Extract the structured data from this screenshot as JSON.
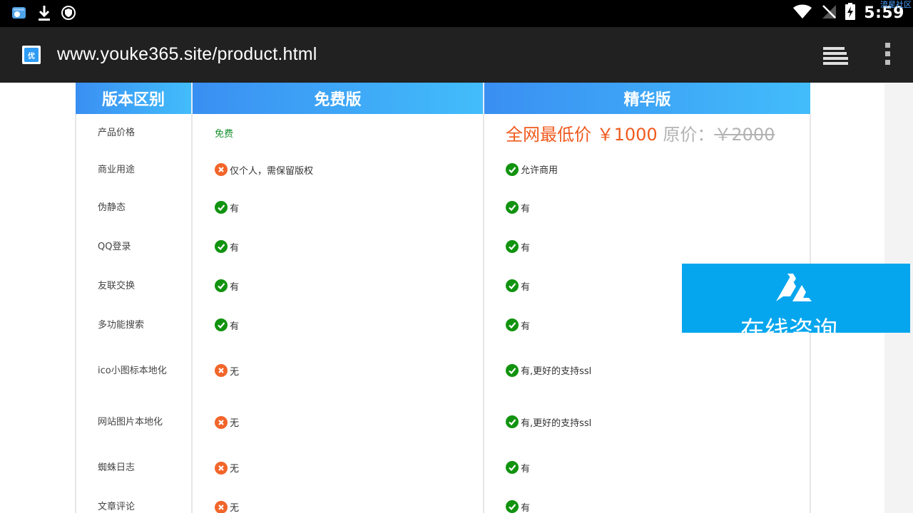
{
  "status_bar": {
    "time": "5:59",
    "corner_text": "流星社区",
    "left_icons": [
      "gallery-app-icon",
      "download-icon",
      "shield-icon"
    ],
    "right_icons": [
      "wifi-icon",
      "no-signal-icon",
      "battery-charging-icon"
    ]
  },
  "browser": {
    "url": "www.youke365.site/product.html",
    "favicon_text": "优"
  },
  "table": {
    "headers": [
      "版本区别",
      "免费版",
      "精华版"
    ],
    "price_row": {
      "label": "产品价格",
      "free": "免费",
      "premium_price": "全网最低价 ￥1000",
      "premium_original_label": "原价：",
      "premium_original_price": "￥2000"
    },
    "rows": [
      {
        "label": "商业用途",
        "free": {
          "ok": false,
          "text": "仅个人，需保留版权"
        },
        "premium": {
          "ok": true,
          "text": "允许商用"
        }
      },
      {
        "label": "伪静态",
        "free": {
          "ok": true,
          "text": "有"
        },
        "premium": {
          "ok": true,
          "text": "有"
        }
      },
      {
        "label": "QQ登录",
        "free": {
          "ok": true,
          "text": "有"
        },
        "premium": {
          "ok": true,
          "text": "有"
        }
      },
      {
        "label": "友联交换",
        "free": {
          "ok": true,
          "text": "有"
        },
        "premium": {
          "ok": true,
          "text": "有"
        }
      },
      {
        "label": "多功能搜索",
        "free": {
          "ok": true,
          "text": "有"
        },
        "premium": {
          "ok": true,
          "text": "有"
        }
      },
      {
        "label": "ico小图标本地化",
        "free": {
          "ok": false,
          "text": "无"
        },
        "premium": {
          "ok": true,
          "text": "有,更好的支持ssl"
        }
      },
      {
        "label": "网站图片本地化",
        "free": {
          "ok": false,
          "text": "无"
        },
        "premium": {
          "ok": true,
          "text": "有,更好的支持ssl"
        }
      },
      {
        "label": "蜘蛛日志",
        "free": {
          "ok": false,
          "text": "无"
        },
        "premium": {
          "ok": true,
          "text": "有"
        }
      },
      {
        "label": "文章评论",
        "free": {
          "ok": false,
          "text": "无"
        },
        "premium": {
          "ok": true,
          "text": "有"
        }
      }
    ]
  },
  "consult": {
    "label": "在线咨询"
  },
  "colors": {
    "header_gradient_start": "#3a8ff2",
    "header_gradient_end": "#42bdfb",
    "ok_green": "#11930f",
    "no_orange": "#f2652a",
    "price_orange": "#f05a1e",
    "consult_blue": "#05a6ee"
  }
}
